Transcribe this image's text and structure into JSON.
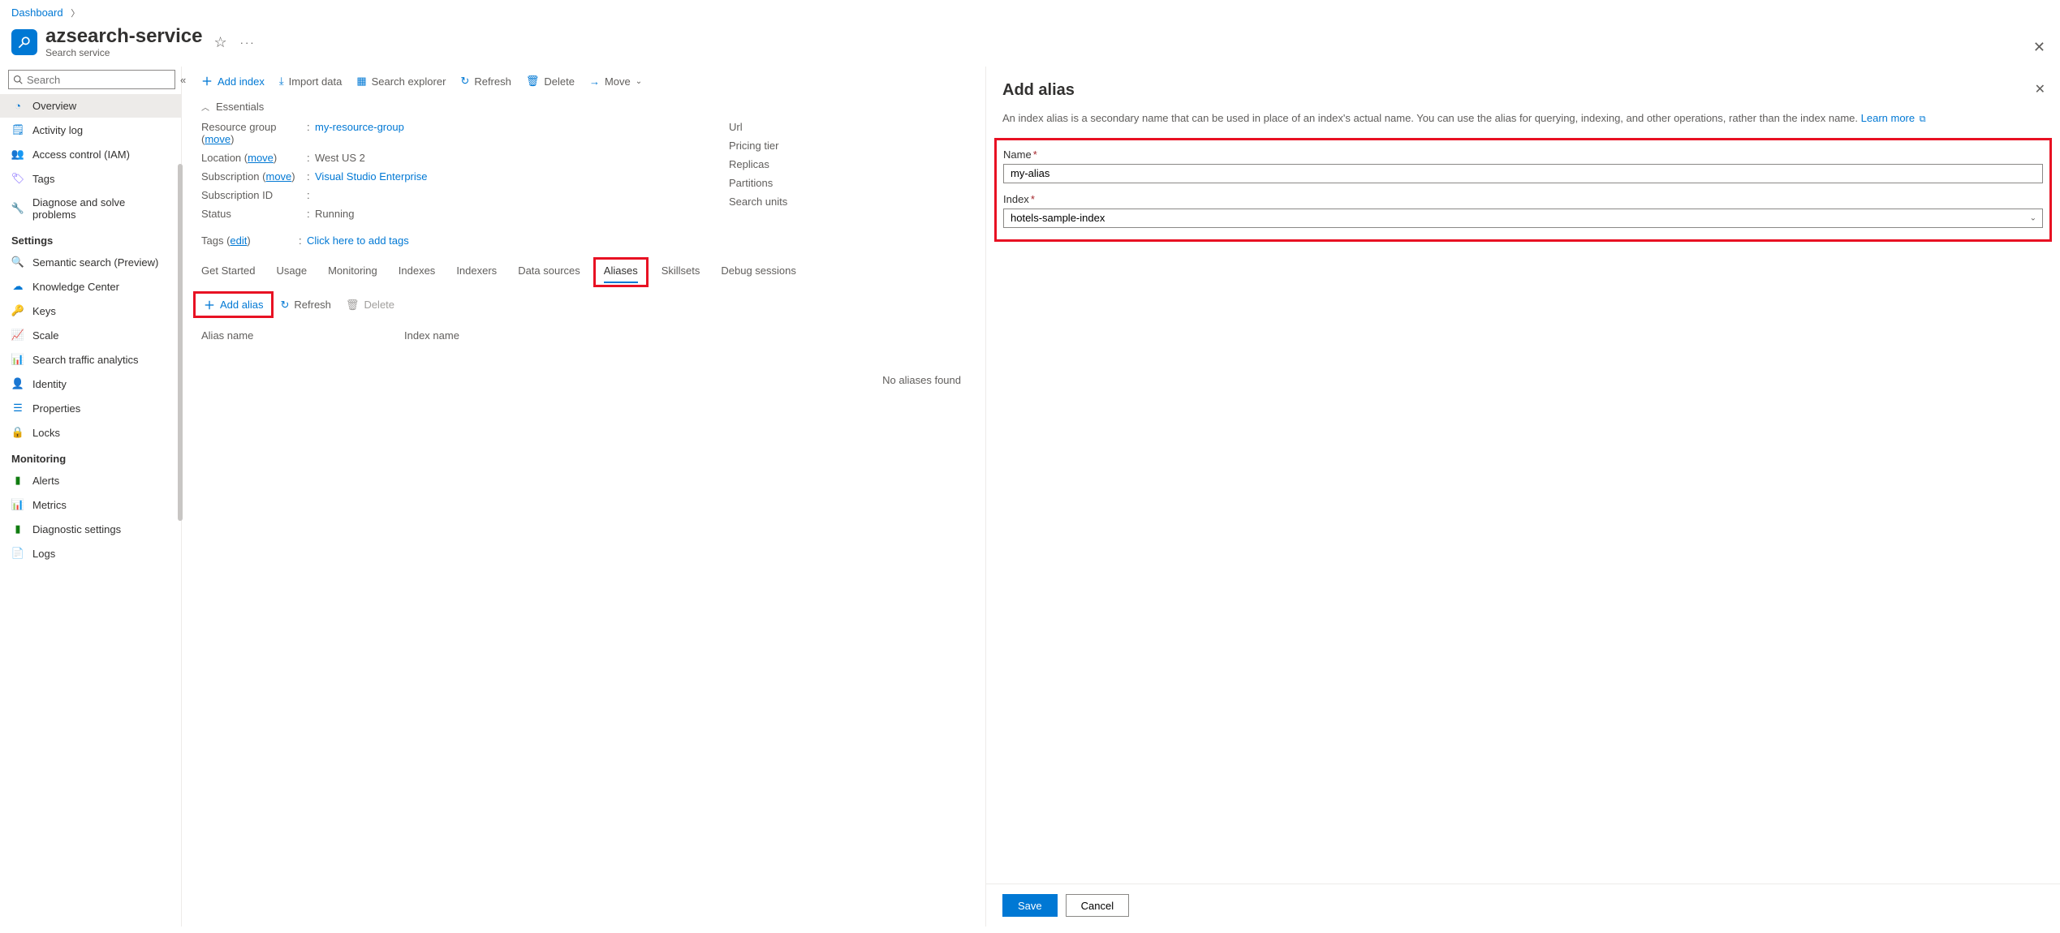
{
  "breadcrumb": {
    "dashboard": "Dashboard"
  },
  "header": {
    "title": "azsearch-service",
    "subtitle": "Search service"
  },
  "sidebar": {
    "search_placeholder": "Search",
    "items": {
      "overview": "Overview",
      "activity_log": "Activity log",
      "access_control": "Access control (IAM)",
      "tags": "Tags",
      "diagnose": "Diagnose and solve problems"
    },
    "settings_header": "Settings",
    "settings": {
      "semantic": "Semantic search (Preview)",
      "knowledge": "Knowledge Center",
      "keys": "Keys",
      "scale": "Scale",
      "traffic": "Search traffic analytics",
      "identity": "Identity",
      "properties": "Properties",
      "locks": "Locks"
    },
    "monitoring_header": "Monitoring",
    "monitoring": {
      "alerts": "Alerts",
      "metrics": "Metrics",
      "diag_settings": "Diagnostic settings",
      "logs": "Logs"
    }
  },
  "toolbar": {
    "add_index": "Add index",
    "import_data": "Import data",
    "search_explorer": "Search explorer",
    "refresh": "Refresh",
    "delete": "Delete",
    "move": "Move"
  },
  "essentials": {
    "toggle": "Essentials",
    "resource_group_label": "Resource group",
    "move": "move",
    "resource_group": "my-resource-group",
    "location_label": "Location",
    "location": "West US 2",
    "subscription_label": "Subscription",
    "subscription": "Visual Studio Enterprise",
    "subscription_id_label": "Subscription ID",
    "subscription_id": "",
    "status_label": "Status",
    "status": "Running",
    "right": {
      "url": "Url",
      "pricing": "Pricing tier",
      "replicas": "Replicas",
      "partitions": "Partitions",
      "search_units": "Search units"
    }
  },
  "tags_row": {
    "label": "Tags",
    "edit": "edit",
    "placeholder": "Click here to add tags"
  },
  "tabs": {
    "get_started": "Get Started",
    "usage": "Usage",
    "monitoring": "Monitoring",
    "indexes": "Indexes",
    "indexers": "Indexers",
    "data_sources": "Data sources",
    "aliases": "Aliases",
    "skillsets": "Skillsets",
    "debug": "Debug sessions"
  },
  "aliases": {
    "add": "Add alias",
    "refresh": "Refresh",
    "delete": "Delete",
    "col_alias": "Alias name",
    "col_index": "Index name",
    "empty": "No aliases found"
  },
  "panel": {
    "title": "Add alias",
    "desc": "An index alias is a secondary name that can be used in place of an index's actual name. You can use the alias for querying, indexing, and other operations, rather than the index name.",
    "learn_more": "Learn more",
    "name_label": "Name",
    "name_value": "my-alias",
    "index_label": "Index",
    "index_value": "hotels-sample-index",
    "save": "Save",
    "cancel": "Cancel"
  }
}
